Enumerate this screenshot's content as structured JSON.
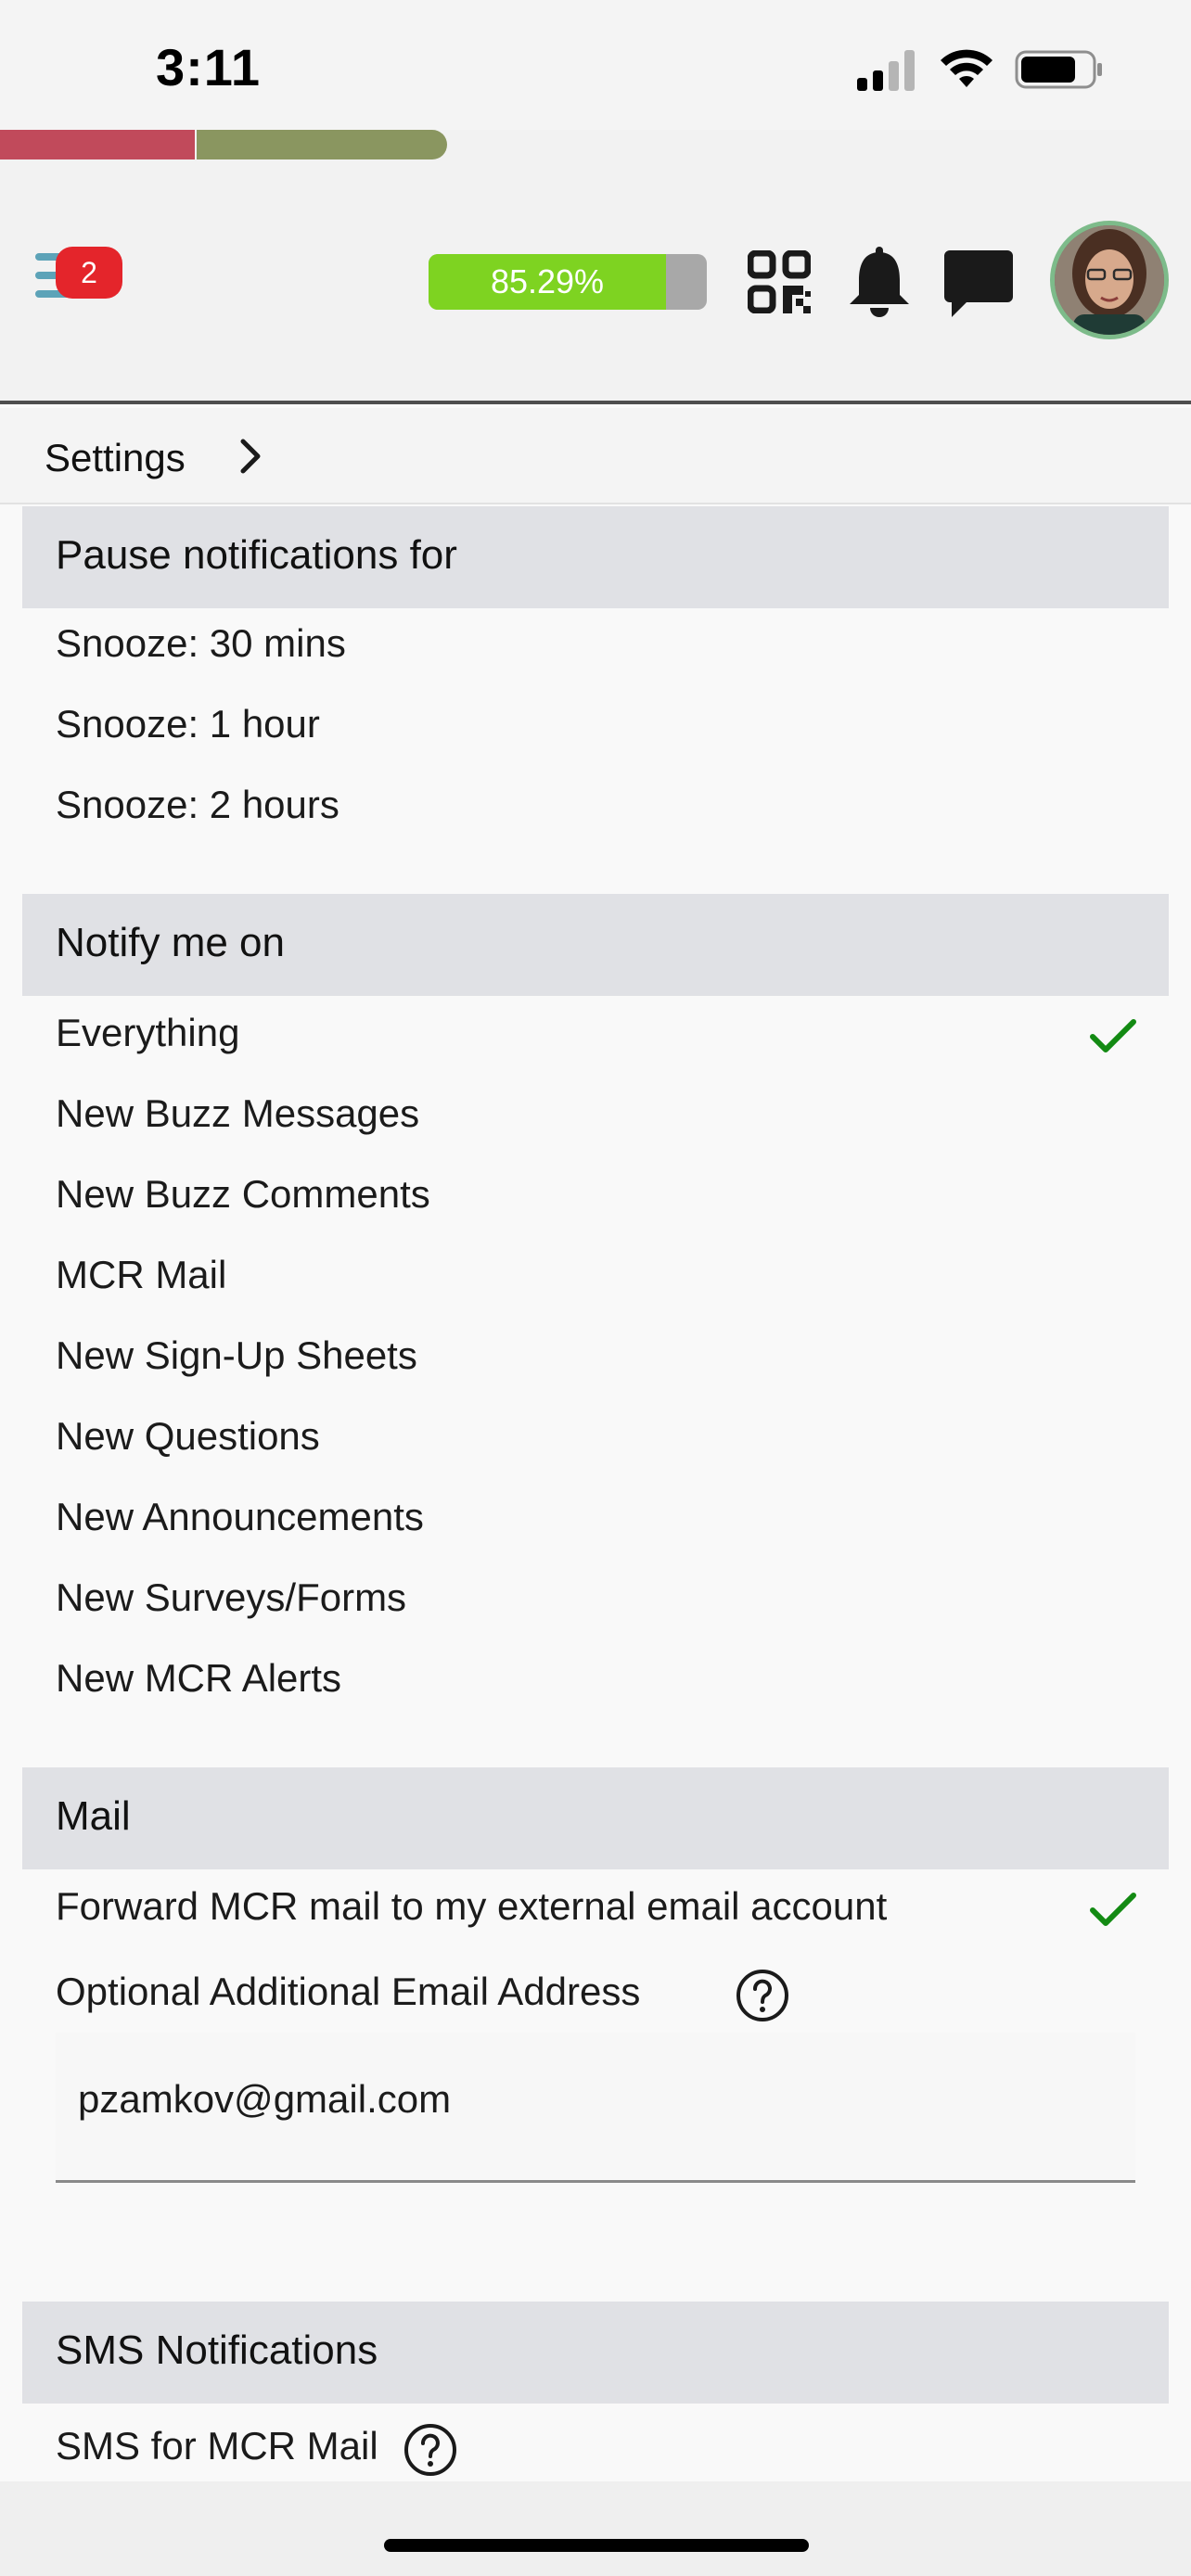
{
  "status_bar": {
    "time": "3:11"
  },
  "header": {
    "menu_badge_count": "2",
    "progress_percent": 85.29,
    "progress_label": "85.29%",
    "icons": [
      "menu-icon",
      "qr-code-icon",
      "bell-icon",
      "chat-icon",
      "avatar"
    ],
    "progress_color": "#7ed321",
    "badge_color": "#e4252b"
  },
  "breadcrumb": {
    "label": "Settings"
  },
  "pause_section": {
    "title": "Pause notifications for",
    "items": [
      "Snooze: 30 mins",
      "Snooze: 1 hour",
      "Snooze: 2 hours"
    ]
  },
  "notify_section": {
    "title": "Notify me on",
    "items": [
      {
        "label": "Everything",
        "checked": true
      },
      {
        "label": "New Buzz Messages",
        "checked": false
      },
      {
        "label": "New Buzz Comments",
        "checked": false
      },
      {
        "label": "MCR Mail",
        "checked": false
      },
      {
        "label": "New Sign-Up Sheets",
        "checked": false
      },
      {
        "label": "New Questions",
        "checked": false
      },
      {
        "label": "New Announcements",
        "checked": false
      },
      {
        "label": "New Surveys/Forms",
        "checked": false
      },
      {
        "label": "New MCR Alerts",
        "checked": false
      }
    ]
  },
  "mail_section": {
    "title": "Mail",
    "forward_label": "Forward MCR mail to my external email account",
    "forward_checked": true,
    "additional_email_label": "Optional Additional Email Address",
    "additional_email_value": "pzamkov@gmail.com"
  },
  "sms_section": {
    "title": "SMS Notifications",
    "sms_mail_label": "SMS for MCR Mail"
  },
  "colors": {
    "check": "#138a13",
    "section_bg": "#e0e1e5",
    "strip_red": "#c14a5b",
    "strip_green": "#8a9660"
  }
}
